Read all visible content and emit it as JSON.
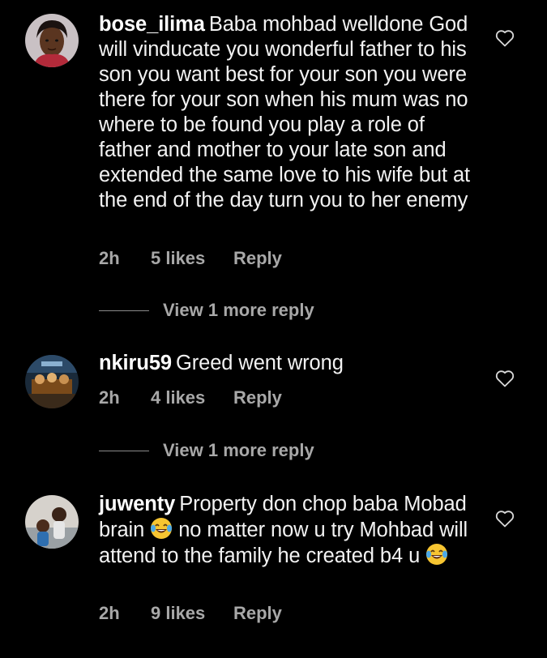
{
  "comments": [
    {
      "username": "bose_ilima",
      "text": "Baba mohbad welldone God will vinducate you  wonderful father to his son  you want best for your son you were there for your son when his mum was no where to be found you play  a role of father and mother to your late son and extended  the same love to his wife but at the end of the day turn you to her enemy",
      "time": "2h",
      "likes": "5 likes",
      "reply": "Reply",
      "view_more": "View 1 more reply"
    },
    {
      "username": "nkiru59",
      "text": "Greed went wrong",
      "time": "2h",
      "likes": "4 likes",
      "reply": "Reply",
      "view_more": "View 1 more reply"
    },
    {
      "username": "juwenty",
      "text_part1": "Property don chop baba Mobad brain",
      "text_part2": "no matter now u try Mohbad will attend to the family he created b4 u",
      "emoji": "laughing-tears-emoji",
      "time": "2h",
      "likes": "9 likes",
      "reply": "Reply"
    }
  ],
  "colors": {
    "background": "#000000",
    "text": "#f2f2f2",
    "meta": "#a8a8a8"
  }
}
